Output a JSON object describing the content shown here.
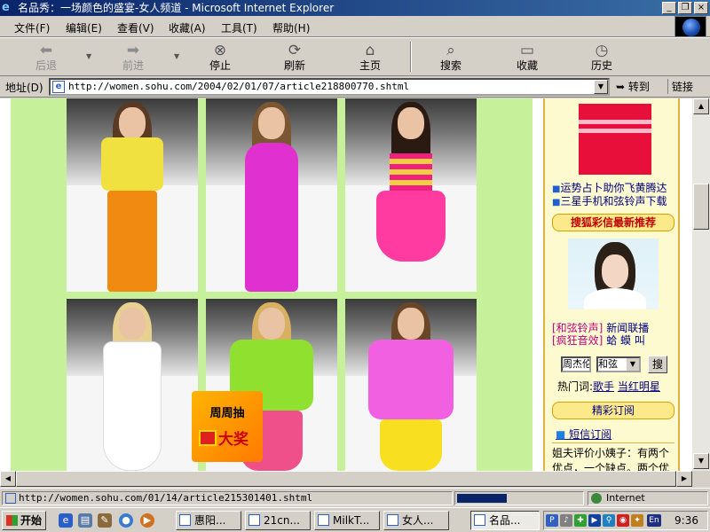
{
  "window": {
    "title": "名品秀：一场颜色的盛宴-女人频道 - Microsoft Internet Explorer"
  },
  "menu": [
    "文件(F)",
    "编辑(E)",
    "查看(V)",
    "收藏(A)",
    "工具(T)",
    "帮助(H)"
  ],
  "toolbar": {
    "back": "后退",
    "forward": "前进",
    "stop": "停止",
    "refresh": "刷新",
    "home": "主页",
    "search": "搜索",
    "favorites": "收藏",
    "history": "历史"
  },
  "address": {
    "label": "地址(D)",
    "url": "http://women.sohu.com/2004/02/01/07/article218800770.shtml",
    "go": "转到",
    "links": "链接"
  },
  "prize_badge": {
    "line1": "周周抽",
    "line2": "大奖"
  },
  "sidebar": {
    "links_top": [
      "运势占卜助你飞黄腾达",
      "三星手机和弦铃声下载"
    ],
    "section_title": "搜狐彩信最新推荐",
    "ring_rows": [
      {
        "tag": "[和弦铃声]",
        "text": "新闻联播"
      },
      {
        "tag": "[疯狂音效]",
        "text": "蛤 蟆 叫"
      }
    ],
    "search": {
      "input_value": "周杰伦",
      "select_value": "和弦",
      "button": "搜"
    },
    "hotwords": {
      "label": "热门词:",
      "items": [
        "歌手",
        "当红明星"
      ]
    },
    "section2_title": "精彩订阅",
    "sms_title": "短信订阅",
    "sms_text": "姐夫评价小姨子：有两个优点，一个缺点。两个优"
  },
  "statusbar": {
    "url": "http://women.sohu.com/01/14/article215301401.shtml",
    "progress": 0.4,
    "zone": "Internet"
  },
  "taskbar": {
    "start": "开始",
    "tasks": [
      "惠阳...",
      "21cn...",
      "MilkT...",
      "女人...",
      "名品..."
    ],
    "clock": "9:36"
  },
  "colors": {
    "title_bar": "#0a246a",
    "green_bg": "#c6f09a",
    "sidebar_bg": "#fdfad0",
    "accent_red": "#c00000"
  }
}
